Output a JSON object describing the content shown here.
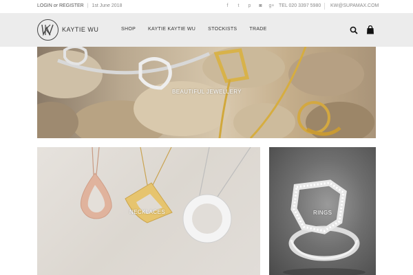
{
  "topbar": {
    "login": "LOGIN",
    "or": "or",
    "register": "REGISTER",
    "divider": "|",
    "date": "1st June 2018",
    "social": [
      {
        "icon": "facebook-icon",
        "glyph": "f"
      },
      {
        "icon": "twitter-icon",
        "glyph": "t"
      },
      {
        "icon": "pinterest-icon",
        "glyph": "p"
      },
      {
        "icon": "instagram-icon",
        "glyph": "◙"
      },
      {
        "icon": "google-plus-icon",
        "glyph": "g+"
      }
    ],
    "phone": "TEL 020 3397 5980",
    "email": "KW@SUPAMAX.COM"
  },
  "header": {
    "brand": "KAYTIE WU",
    "nav": [
      "SHOP",
      "KAYTIE KAYTIE WU",
      "STOCKISTS",
      "TRADE"
    ]
  },
  "tiles": {
    "hero_label": "BEAUTIFUL JEWELLERY",
    "necklaces_label": "NECKLACES",
    "rings_label": "RINGS"
  }
}
